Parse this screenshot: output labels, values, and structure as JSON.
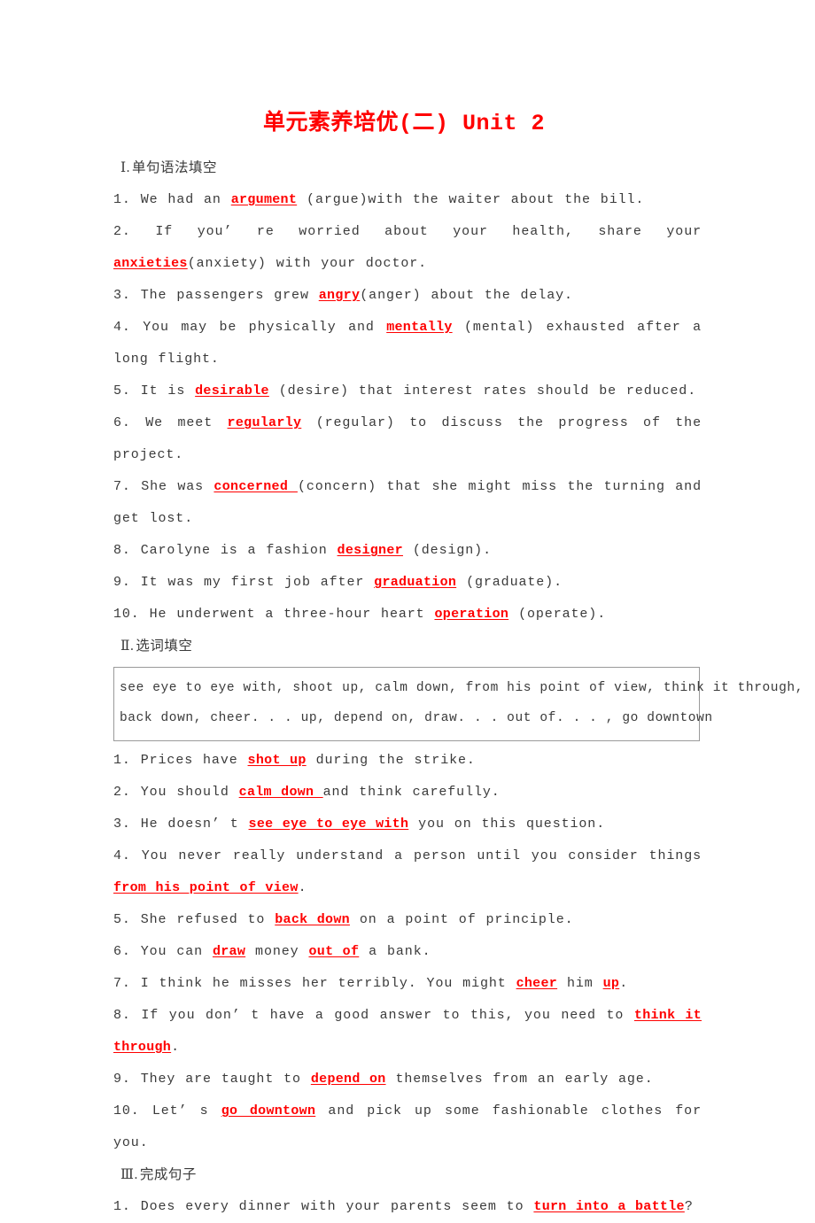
{
  "document": {
    "title": "单元素养培优(二) Unit 2",
    "title_color": "#ff0000",
    "page_background": "#ffffff"
  },
  "sections": [
    {
      "marker": "Ⅰ.",
      "heading": "单句语法填空",
      "items": [
        {
          "index": "1.",
          "before": " We had an ",
          "answer": "argument",
          "after": " (argue)with the waiter about the bill."
        },
        {
          "index": "2.",
          "before": " If you’ re worried about your health, share your ",
          "answer": "anxieties",
          "after": "(anxiety) with your doctor."
        },
        {
          "index": "3.",
          "before": " The passengers grew ",
          "answer": "angry",
          "after": "(anger) about the delay."
        },
        {
          "index": "4.",
          "before": " You may be physically and ",
          "answer": "mentally",
          "after": " (mental) exhausted after a long flight."
        },
        {
          "index": "5.",
          "before": " It is ",
          "answer": "desirable",
          "after": " (desire) that interest rates should be reduced."
        },
        {
          "index": "6.",
          "before": " We meet ",
          "answer": "regularly",
          "after": " (regular) to discuss the progress of the project."
        },
        {
          "index": "7.",
          "before": " She was ",
          "answer": "concerned ",
          "after": "(concern) that she might miss the turning and get lost."
        },
        {
          "index": "8.",
          "before": " Carolyne is a fashion ",
          "answer": "designer",
          "after": " (design)."
        },
        {
          "index": "9.",
          "before": " It was my first job after ",
          "answer": "graduation",
          "after": " (graduate)."
        },
        {
          "index": "10.",
          "before": " He underwent a three-hour heart ",
          "answer": "operation",
          "after": " (operate)."
        }
      ]
    },
    {
      "marker": "Ⅱ.",
      "heading": "选词填空",
      "wordbank": [
        "see eye to eye with, shoot up, calm down, from his point of view, think it through,",
        "back down, cheer. . . up, depend on, draw. . . out of. . . , go downtown"
      ],
      "items": [
        {
          "index": "1.",
          "before": " Prices have ",
          "answer": "shot up",
          "after": " during the strike."
        },
        {
          "index": "2.",
          "before": " You should ",
          "answer": "calm down ",
          "after": "and think carefully."
        },
        {
          "index": "3.",
          "before": " He doesn’ t ",
          "answer": "see eye to eye with",
          "after": " you on this question."
        },
        {
          "index": "4.",
          "before": " You never really understand a person until you consider things ",
          "answer": "from his point of view",
          "after": "."
        },
        {
          "index": "5.",
          "before": " She refused to ",
          "answer": "back down",
          "after": " on a point of principle."
        },
        {
          "index": "6.",
          "before": " You can ",
          "answer": "draw",
          "mid": " money ",
          "answer2": "out of",
          "after": " a bank."
        },
        {
          "index": "7.",
          "before": " I think he misses her terribly. You might ",
          "answer": "cheer",
          "mid": " him ",
          "answer2": "up",
          "after": "."
        },
        {
          "index": "8.",
          "before": " If you don’ t have a good answer to this, you need to ",
          "answer": "think it through",
          "after": "."
        },
        {
          "index": "9.",
          "before": " They are taught to ",
          "answer": "depend on",
          "after": " themselves from an early age."
        },
        {
          "index": "10.",
          "before": " Let’ s ",
          "answer": "go downtown",
          "after": " and pick up some fashionable clothes for you."
        }
      ]
    },
    {
      "marker": "Ⅲ.",
      "heading": "完成句子",
      "items": [
        {
          "index": "1.",
          "before": " Does every dinner with your parents seem to ",
          "answer": "turn into a battle",
          "after": "?"
        }
      ]
    }
  ]
}
